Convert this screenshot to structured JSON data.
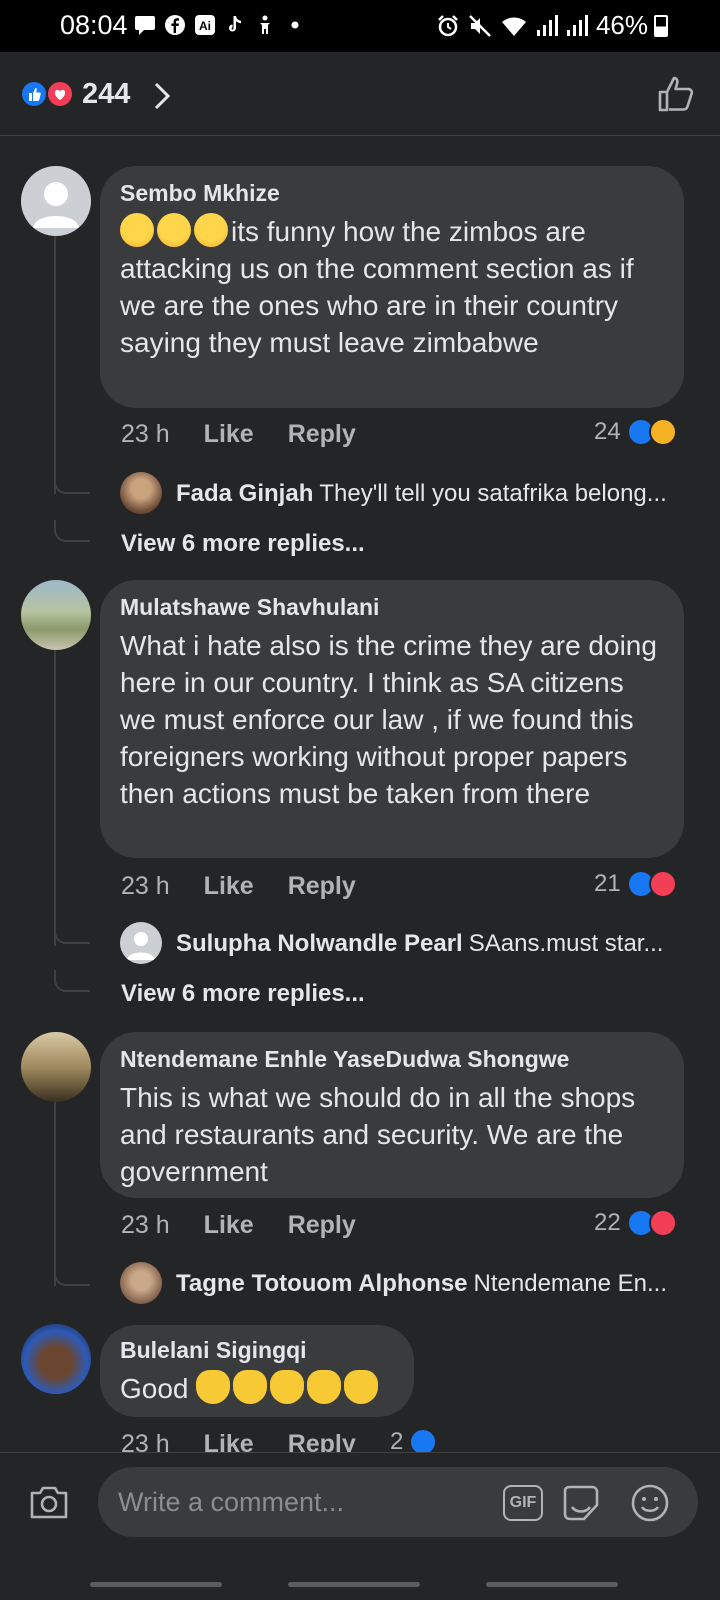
{
  "status_bar": {
    "time": "08:04",
    "battery": "46%"
  },
  "header": {
    "reaction_count": "244"
  },
  "comments": [
    {
      "name": "Sembo Mkhize",
      "text": "its funny how the zimbos are attacking us on the comment section as if we are the ones who are in their country  saying they must leave zimbabwe",
      "time": "23 h",
      "like_label": "Like",
      "reply_label": "Reply",
      "reactions_count": "24",
      "reply_preview": {
        "name": "Fada Ginjah",
        "text": "They'll tell you satafrika belong..."
      },
      "view_more": "View 6 more replies..."
    },
    {
      "name": "Mulatshawe Shavhulani",
      "text": "What i hate also is the crime they are doing here in our country.  I think as SA citizens we must enforce our law , if we found this foreigners working without proper papers then actions must be taken from there",
      "time": "23 h",
      "like_label": "Like",
      "reply_label": "Reply",
      "reactions_count": "21",
      "reply_preview": {
        "name": "Sulupha Nolwandle Pearl",
        "text": "SAans.must star..."
      },
      "view_more": "View 6 more replies..."
    },
    {
      "name": "Ntendemane Enhle YaseDudwa Shongwe",
      "text": "This is what we should do in all the shops and restaurants and security. We are the government",
      "time": "23 h",
      "like_label": "Like",
      "reply_label": "Reply",
      "reactions_count": "22",
      "reply_preview": {
        "name": "Tagne Totouom Alphonse",
        "text": "Ntendemane En..."
      }
    },
    {
      "name": "Bulelani Sigingqi",
      "text": "Good",
      "time": "23 h",
      "like_label": "Like",
      "reply_label": "Reply",
      "reactions_count": "2"
    }
  ],
  "composer": {
    "placeholder": "Write a comment...",
    "gif_label": "GIF"
  },
  "colors": {
    "background": "#242526",
    "bubble": "#3a3b3c",
    "like_blue": "#1877f2",
    "love_red": "#f33e58"
  }
}
